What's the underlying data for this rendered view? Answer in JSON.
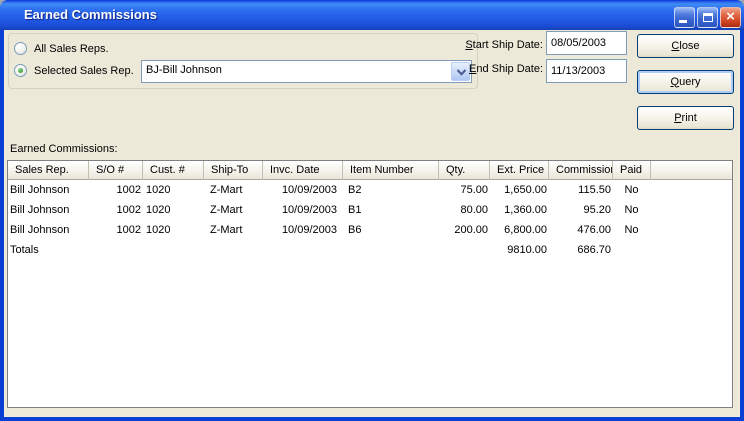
{
  "titlebar": {
    "title": "Earned Commissions",
    "close_glyph": "×"
  },
  "filters": {
    "all_sales_reps_label": "All Sales Reps.",
    "selected_sales_rep_label": "Selected Sales Rep.",
    "selected_sales_rep_value": "BJ-Bill Johnson",
    "start_date": {
      "mnemonic": "S",
      "label_rest": "tart Ship Date:",
      "value": "08/05/2003"
    },
    "end_date": {
      "mnemonic": "E",
      "label_rest": "nd Ship Date:",
      "value": "11/13/2003"
    }
  },
  "actions": {
    "close": {
      "mnemonic": "C",
      "rest": "lose"
    },
    "query": {
      "mnemonic": "Q",
      "rest": "uery"
    },
    "print": {
      "mnemonic": "P",
      "rest": "rint"
    }
  },
  "grid": {
    "label": "Earned Commissions:",
    "columns": [
      "Sales Rep.",
      "S/O #",
      "Cust. #",
      "Ship-To",
      "Invc. Date",
      "Item Number",
      "Qty.",
      "Ext. Price",
      "Commission",
      "Paid"
    ],
    "rows": [
      {
        "sales_rep": "Bill Johnson",
        "so_no": "1002",
        "cust_no": "1020",
        "ship_to": "Z-Mart",
        "invc_date": "10/09/2003",
        "item_number": "B2",
        "qty": "75.00",
        "ext_price": "1,650.00",
        "commission": "115.50",
        "paid": "No"
      },
      {
        "sales_rep": "Bill Johnson",
        "so_no": "1002",
        "cust_no": "1020",
        "ship_to": "Z-Mart",
        "invc_date": "10/09/2003",
        "item_number": "B1",
        "qty": "80.00",
        "ext_price": "1,360.00",
        "commission": "95.20",
        "paid": "No"
      },
      {
        "sales_rep": "Bill Johnson",
        "so_no": "1002",
        "cust_no": "1020",
        "ship_to": "Z-Mart",
        "invc_date": "10/09/2003",
        "item_number": "B6",
        "qty": "200.00",
        "ext_price": "6,800.00",
        "commission": "476.00",
        "paid": "No"
      }
    ],
    "totals": {
      "sales_rep": "Totals",
      "ext_price": "9810.00",
      "commission": "686.70"
    }
  },
  "colors": {
    "dialog_bg": "#ECE9D8",
    "window_border_blue": "#0A3FD3",
    "titlebar_blue": "#2460E8",
    "close_button_red": "#D44A28",
    "radio_dot_green": "#3CA03C",
    "grid_header_line": "#ACA899",
    "input_border": "#7F9DB9",
    "button_border": "#003C74"
  }
}
